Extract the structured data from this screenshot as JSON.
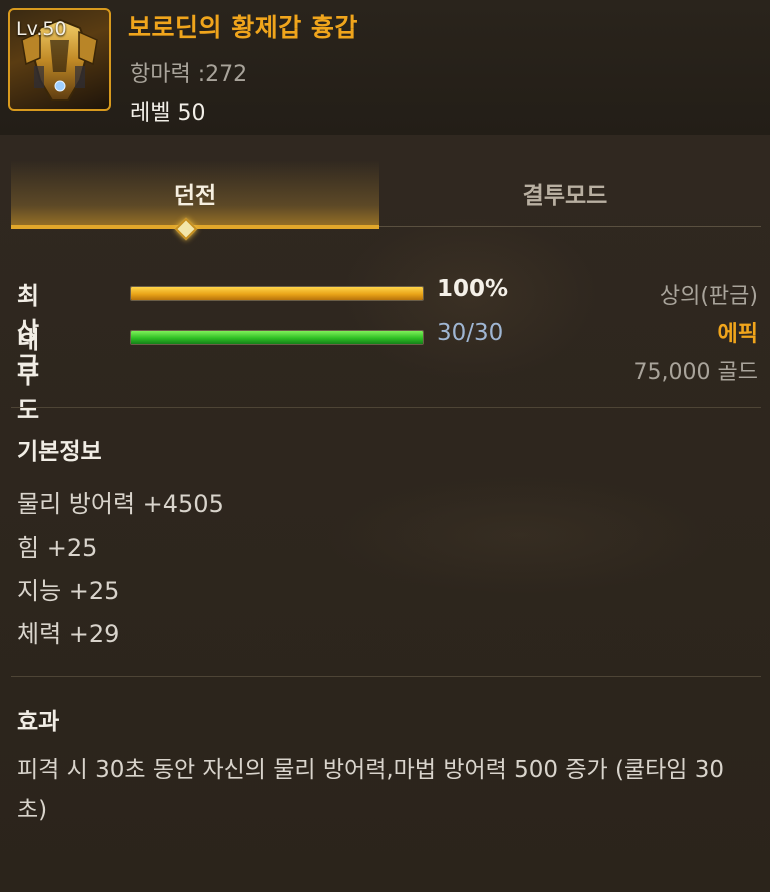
{
  "item": {
    "level_badge": "Lv.50",
    "name": "보로딘의 황제갑 흉갑",
    "resist_label": "항마력 : ",
    "resist_value": "272",
    "level_text": "레벨 50",
    "border_color": "#d89a1e",
    "icon": "armor-chest-icon"
  },
  "tabs": [
    {
      "label": "던전",
      "active": true
    },
    {
      "label": "결투모드",
      "active": false
    }
  ],
  "stats": {
    "grade": {
      "label": "최상급",
      "value": "100%",
      "fill_percent": 100,
      "color": "#e9a418"
    },
    "durability": {
      "label": "내구도",
      "value": "30/30",
      "current": 30,
      "max": 30,
      "color": "#2fbf24"
    }
  },
  "info": {
    "slot": "상의(판금)",
    "rarity": "에픽",
    "rarity_color": "#f0a51c",
    "price": "75,000 골드"
  },
  "basic_info": {
    "title": "기본정보",
    "lines": [
      "물리 방어력 +4505",
      "힘 +25",
      "지능 +25",
      "체력 +29"
    ]
  },
  "effect": {
    "title": "효과",
    "text": "피격 시 30초 동안 자신의 물리 방어력,마법 방어력 500 증가 (쿨타임 30초)"
  }
}
